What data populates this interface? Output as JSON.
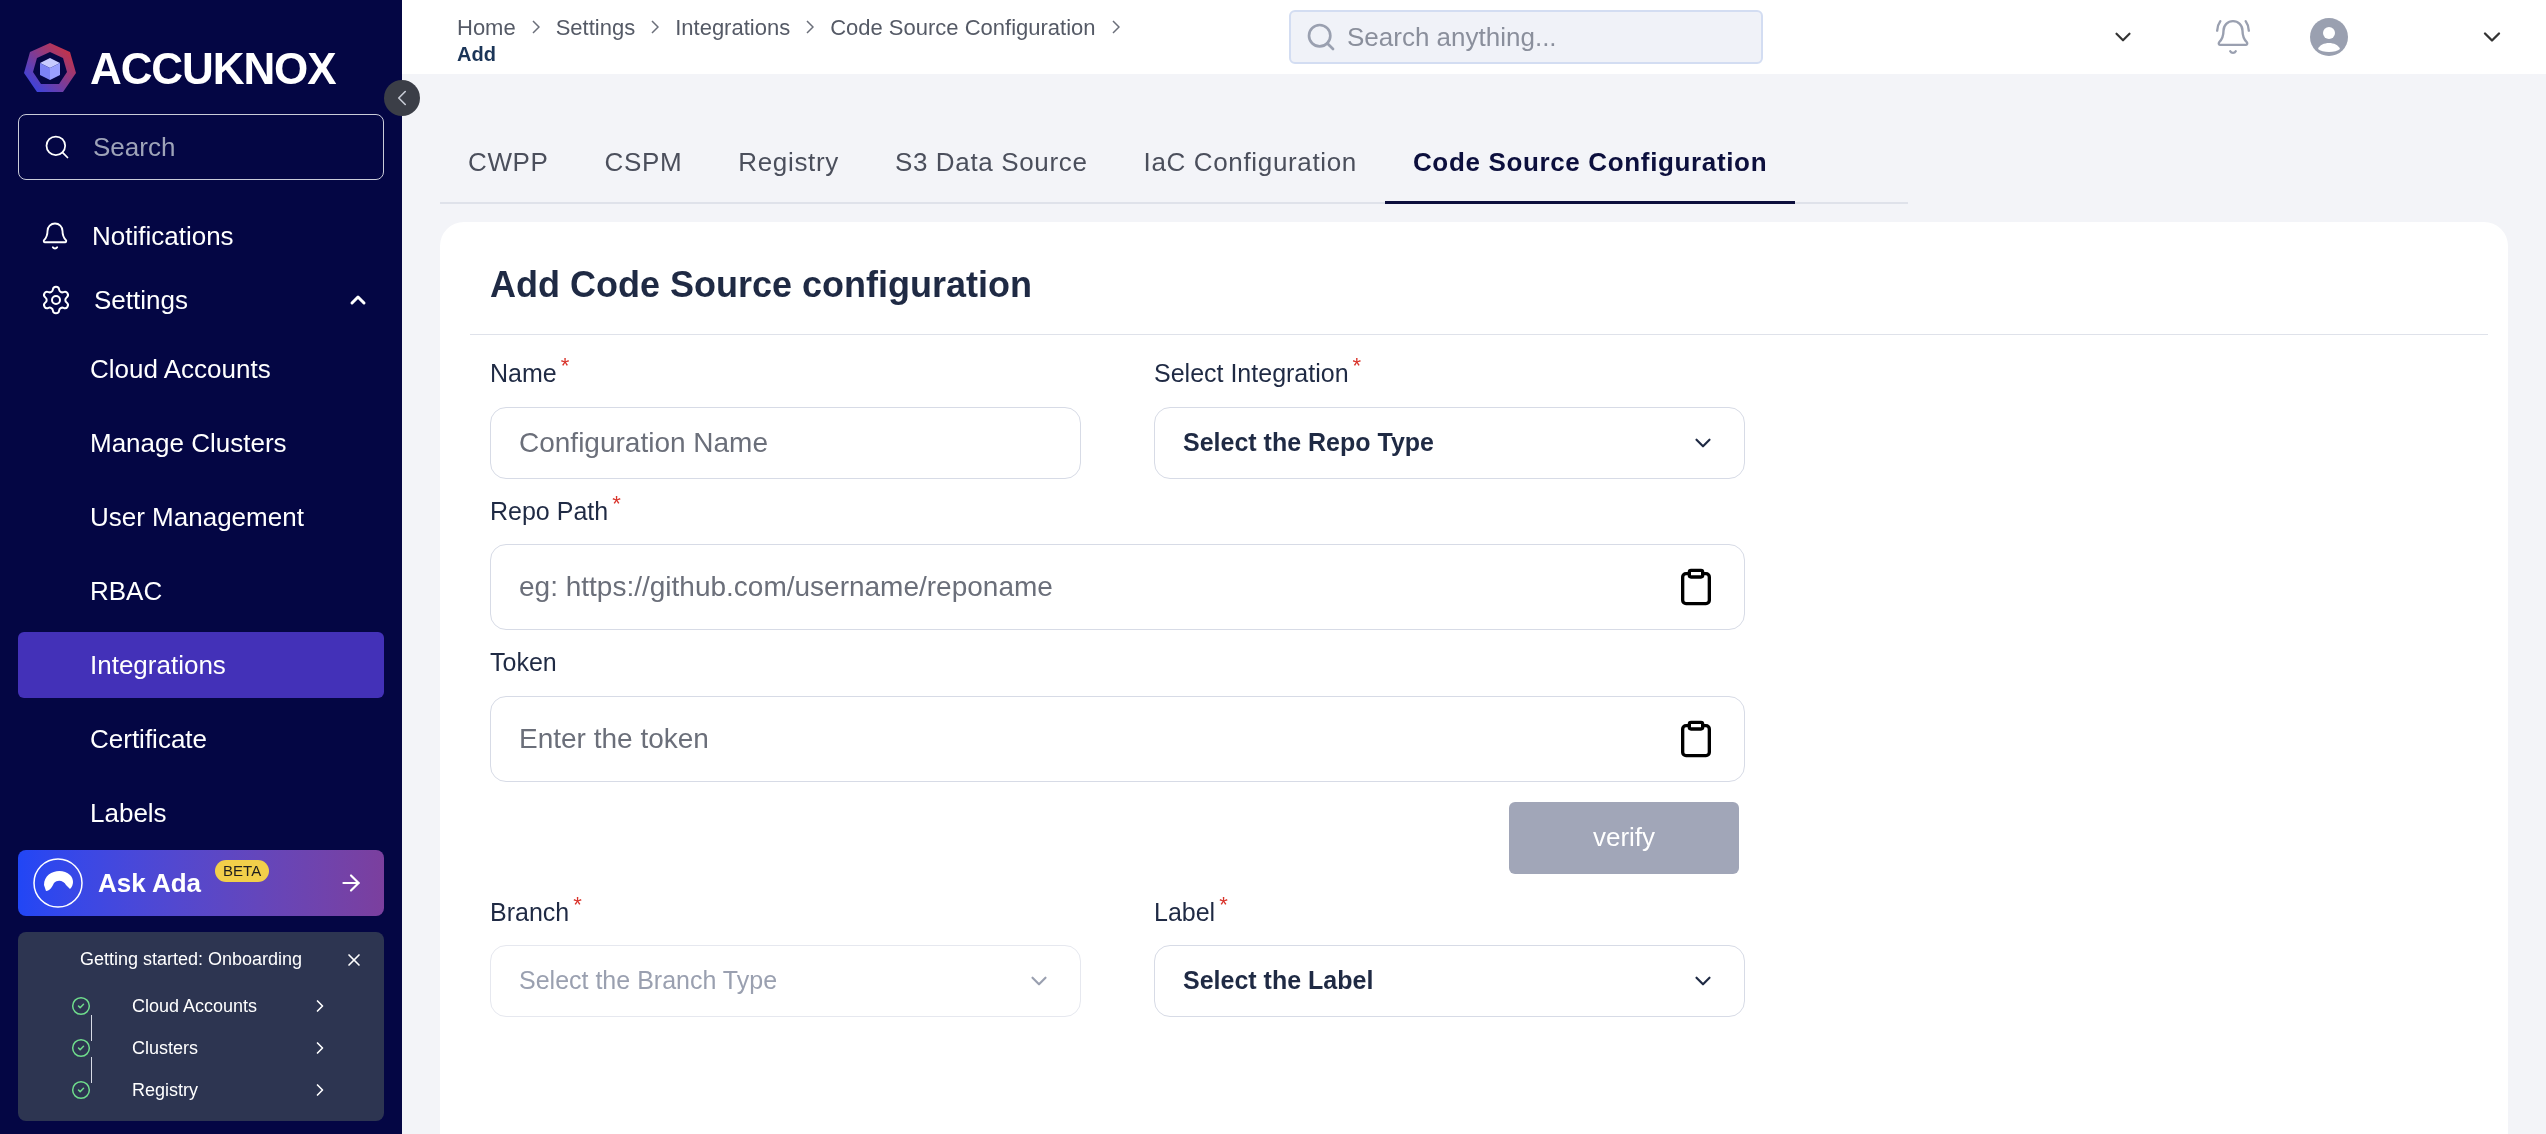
{
  "brand": {
    "name": "ACCUKNOX"
  },
  "sidebar": {
    "search": {
      "placeholder": "Search"
    },
    "items": [
      {
        "kind": "bell",
        "label": "Notifications"
      },
      {
        "kind": "gear",
        "label": "Settings",
        "expanded": true,
        "children": [
          {
            "label": "Cloud Accounts",
            "selected": false
          },
          {
            "label": "Manage Clusters",
            "selected": false
          },
          {
            "label": "User Management",
            "selected": false
          },
          {
            "label": "RBAC",
            "selected": false
          },
          {
            "label": "Integrations",
            "selected": true
          },
          {
            "label": "Certificate",
            "selected": false
          },
          {
            "label": "Labels",
            "selected": false
          }
        ]
      }
    ],
    "ask_ada": {
      "label": "Ask Ada",
      "badge": "BETA"
    },
    "onboarding": {
      "title": "Getting started: Onboarding",
      "steps": [
        {
          "label": "Cloud Accounts",
          "done": true
        },
        {
          "label": "Clusters",
          "done": true
        },
        {
          "label": "Registry",
          "done": true
        }
      ]
    }
  },
  "header": {
    "breadcrumb": [
      "Home",
      "Settings",
      "Integrations",
      "Code Source Configuration"
    ],
    "current": "Add",
    "search": {
      "placeholder": "Search anything..."
    }
  },
  "tabs": [
    {
      "label": "CWPP",
      "selected": false
    },
    {
      "label": "CSPM",
      "selected": false
    },
    {
      "label": "Registry",
      "selected": false
    },
    {
      "label": "S3 Data Source",
      "selected": false
    },
    {
      "label": "IaC Configuration",
      "selected": false
    },
    {
      "label": "Code Source Configuration",
      "selected": true
    }
  ],
  "form": {
    "title": "Add Code Source configuration",
    "rows": [
      {
        "kind": "fields",
        "fields": [
          {
            "kind": "text",
            "label": "Name",
            "required_mark": "*",
            "placeholder": "Configuration Name"
          },
          {
            "kind": "select",
            "label": "Select Integration",
            "required_mark": "*",
            "value": "Select the Repo Type",
            "disabled": false
          }
        ]
      },
      {
        "kind": "fields",
        "fields": [
          {
            "kind": "paste",
            "label": "Repo Path",
            "required_mark": "*",
            "placeholder": "eg: https://github.com/username/reponame"
          }
        ]
      },
      {
        "kind": "fields",
        "fields": [
          {
            "kind": "paste",
            "label": "Token",
            "placeholder": "Enter the token"
          }
        ]
      },
      {
        "kind": "button",
        "label": "verify",
        "disabled": true
      },
      {
        "kind": "fields",
        "fields": [
          {
            "kind": "select",
            "label": "Branch",
            "required_mark": "*",
            "placeholder": "Select the Branch Type",
            "disabled": true
          },
          {
            "kind": "select",
            "label": "Label",
            "required_mark": "*",
            "value": "Select the Label",
            "disabled": false
          }
        ]
      }
    ]
  }
}
